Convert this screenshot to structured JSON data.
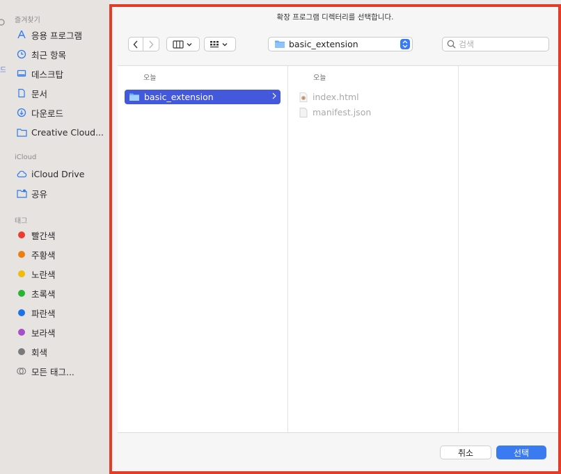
{
  "dialog": {
    "title": "확장 프로그램 디렉터리를 선택합니다.",
    "path_label": "basic_extension",
    "search_placeholder": "검색",
    "cancel_label": "취소",
    "select_label": "선택"
  },
  "sidebar": {
    "favorites_header": "즐겨찾기",
    "favorites": [
      {
        "label": "응용 프로그램",
        "icon": "apps-icon"
      },
      {
        "label": "최근 항목",
        "icon": "clock-icon"
      },
      {
        "label": "데스크탑",
        "icon": "desktop-icon"
      },
      {
        "label": "문서",
        "icon": "document-icon"
      },
      {
        "label": "다운로드",
        "icon": "download-icon"
      },
      {
        "label": "Creative Cloud...",
        "icon": "folder-icon"
      }
    ],
    "icloud_header": "iCloud",
    "icloud": [
      {
        "label": "iCloud Drive",
        "icon": "cloud-icon"
      },
      {
        "label": "공유",
        "icon": "shared-folder-icon"
      }
    ],
    "tags_header": "태그",
    "tags": [
      {
        "label": "빨간색",
        "color": "#ee3b30"
      },
      {
        "label": "주황색",
        "color": "#ef7e10"
      },
      {
        "label": "노란색",
        "color": "#f1bb0b"
      },
      {
        "label": "초록색",
        "color": "#27b533"
      },
      {
        "label": "파란색",
        "color": "#1a73e8"
      },
      {
        "label": "보라색",
        "color": "#a64fc9"
      },
      {
        "label": "회색",
        "color": "#7a7a7a"
      }
    ],
    "all_tags_label": "모든 태그..."
  },
  "browser": {
    "col1": {
      "header": "오늘",
      "items": [
        {
          "name": "basic_extension",
          "selected": true
        }
      ]
    },
    "col2": {
      "header": "오늘",
      "items": [
        {
          "name": "index.html",
          "icon": "html-file-icon"
        },
        {
          "name": "manifest.json",
          "icon": "json-file-icon"
        }
      ]
    }
  },
  "colors": {
    "accent": "#4358da",
    "highlight_border": "#e23d28",
    "primary_button": "#3a7bf2"
  }
}
